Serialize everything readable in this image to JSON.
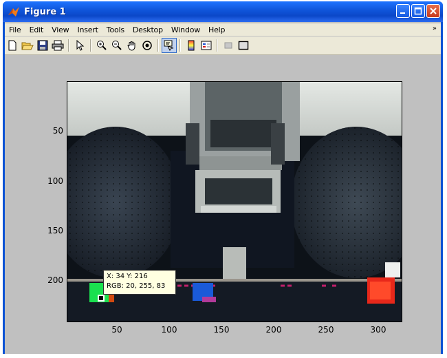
{
  "window": {
    "title": "Figure 1"
  },
  "menu": {
    "items": [
      "File",
      "Edit",
      "View",
      "Insert",
      "Tools",
      "Desktop",
      "Window",
      "Help"
    ]
  },
  "toolbar": {
    "tools": [
      {
        "name": "new-figure-icon"
      },
      {
        "name": "open-file-icon"
      },
      {
        "name": "save-icon"
      },
      {
        "name": "print-icon"
      },
      {
        "name": "select-arrow-icon"
      },
      {
        "name": "zoom-in-icon"
      },
      {
        "name": "zoom-out-icon"
      },
      {
        "name": "pan-hand-icon"
      },
      {
        "name": "rotate-3d-icon"
      },
      {
        "name": "data-cursor-icon",
        "active": true
      },
      {
        "name": "colorbar-icon"
      },
      {
        "name": "legend-icon"
      },
      {
        "name": "hide-plot-tools-icon"
      },
      {
        "name": "show-plot-tools-icon"
      }
    ]
  },
  "axes": {
    "yticks": [
      "50",
      "100",
      "150",
      "200"
    ],
    "xticks": [
      "50",
      "100",
      "150",
      "200",
      "250",
      "300"
    ]
  },
  "datatip": {
    "line1": "X: 34 Y: 216",
    "line2": "RGB: 20, 255, 83"
  },
  "colors": {
    "title_bar": "#0b47c8",
    "chrome": "#ece9d8",
    "figure_bg": "#c0c0c0"
  }
}
